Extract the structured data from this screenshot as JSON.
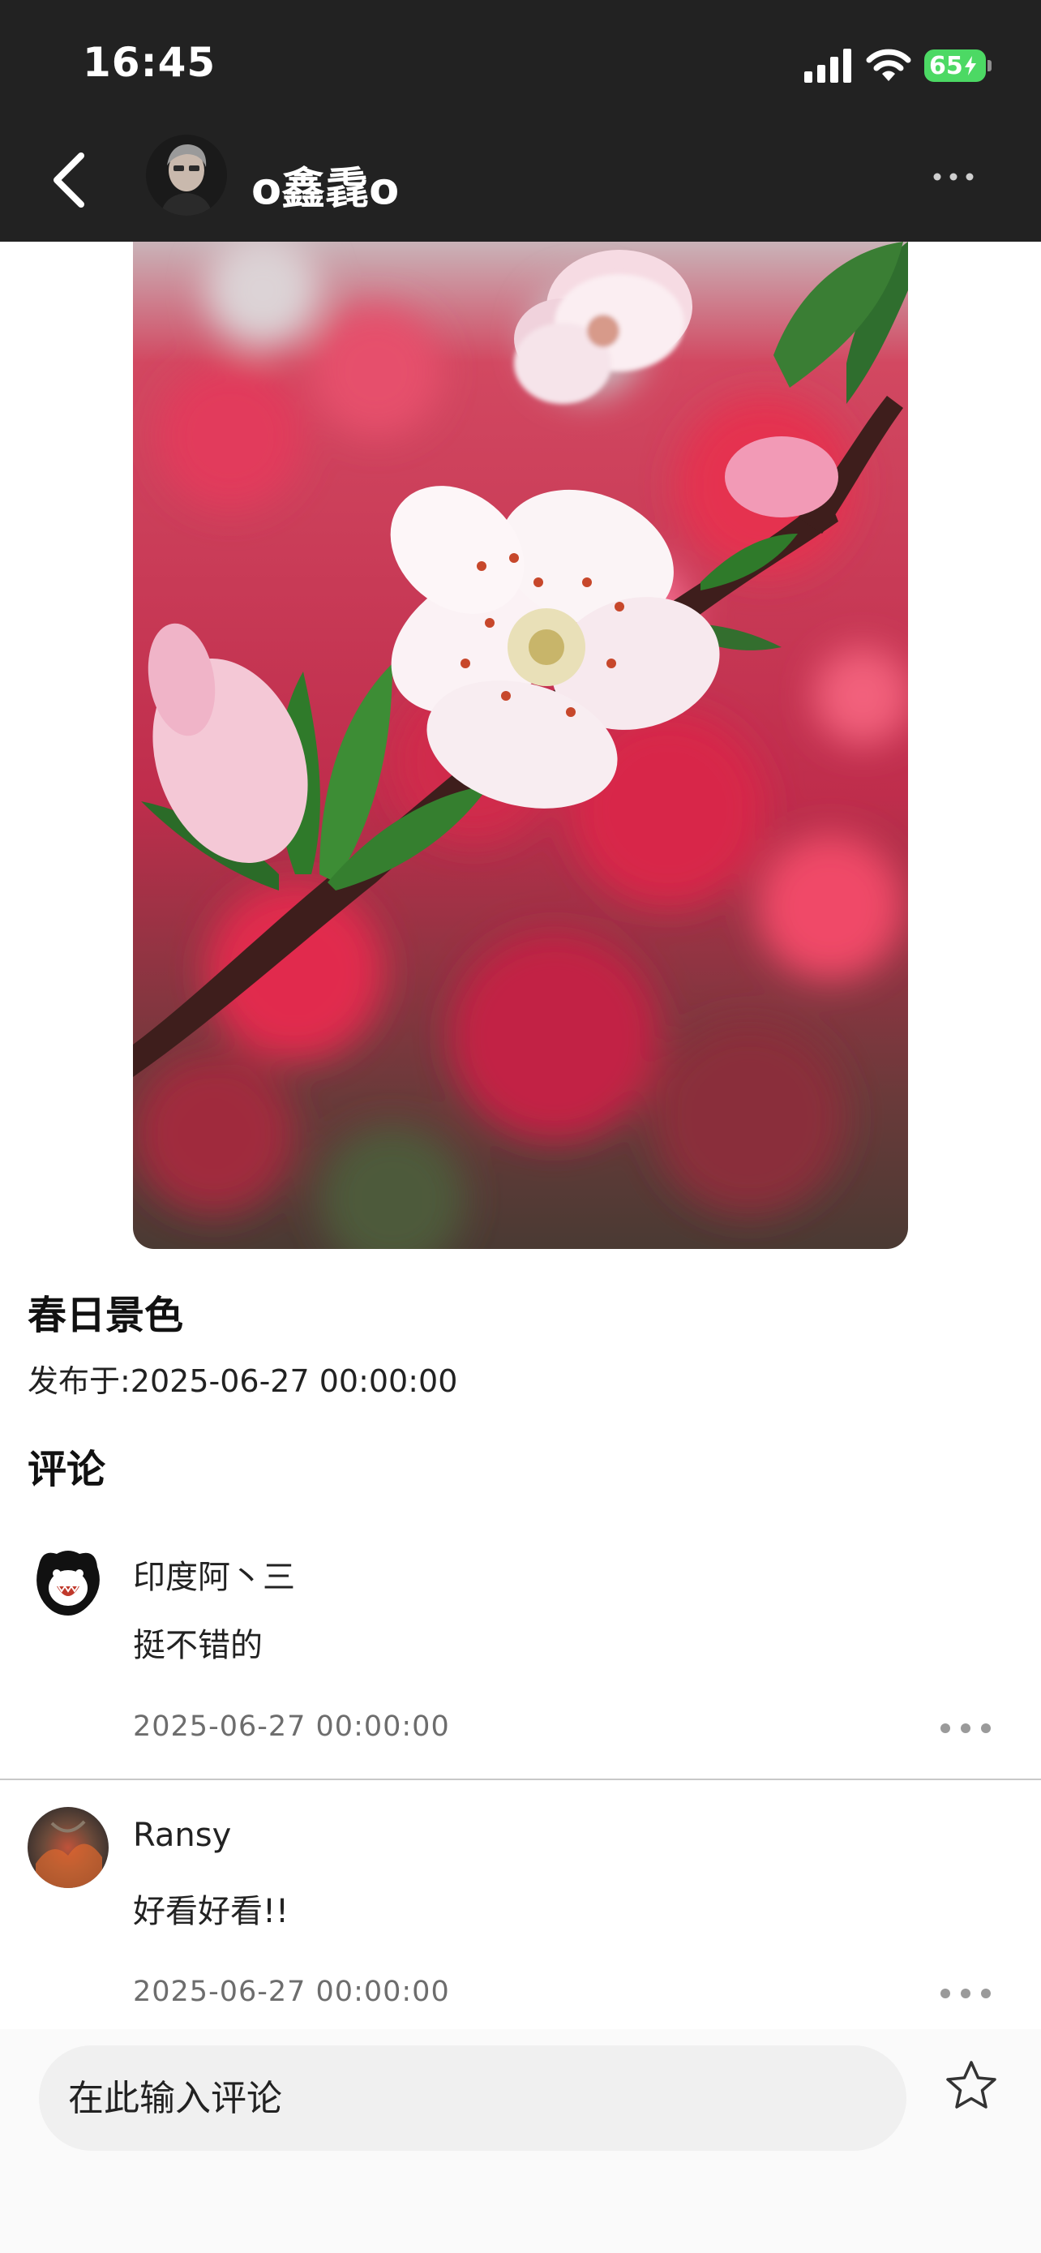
{
  "status_bar": {
    "time": "16:45",
    "battery": "65",
    "icons": [
      "signal-icon",
      "wifi-icon",
      "battery-icon"
    ]
  },
  "header": {
    "author_name": "o鑫毳o",
    "icons": [
      "back-arrow-icon",
      "more-horizontal-icon"
    ]
  },
  "post": {
    "title": "春日景色",
    "published": "发布于:2025-06-27 00:00:00"
  },
  "comments_section": {
    "heading": "评论",
    "items": [
      {
        "user": "印度阿丶三",
        "text": "挺不错的",
        "time": "2025-06-27 00:00:00"
      },
      {
        "user": "Ransy",
        "text": "好看好看!!",
        "time": "2025-06-27 00:00:00"
      }
    ]
  },
  "input": {
    "placeholder": "在此输入评论"
  },
  "colors": {
    "header_background": "#222222",
    "battery_green": "#4cd964",
    "secondary_text": "#6d6d6d",
    "input_background": "#f0f0f0"
  }
}
